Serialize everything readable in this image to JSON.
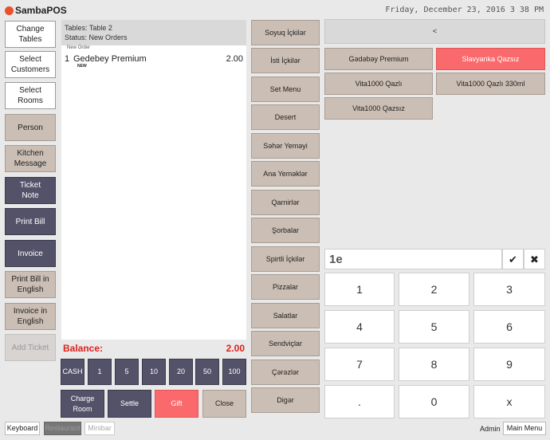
{
  "app": {
    "logo_text": "SambaPOS",
    "datetime": "Friday, December 23, 2016 3 38 PM"
  },
  "left_buttons": [
    "Change Tables",
    "Select Customers",
    "Select Rooms",
    "Person",
    "Kitchen Message",
    "Ticket Note",
    "Print Bill",
    "Invoice",
    "Print Bill in English",
    "Invoice in English",
    "Add Ticket"
  ],
  "ticket": {
    "table": "Tables: Table 2",
    "status": "Status: New Orders",
    "group_label": "New Order",
    "items": [
      {
        "qty": "1",
        "name": "Gedebey Premium",
        "price": "2.00",
        "tag": "NEW"
      }
    ],
    "balance_label": "Balance:",
    "balance_value": "2.00"
  },
  "cash_row": [
    "CASH",
    "1",
    "5",
    "10",
    "20",
    "50",
    "100"
  ],
  "action_row": [
    "Charge Room",
    "Settle",
    "Gift",
    "Close"
  ],
  "categories": [
    "Soyuq İçkilər",
    "İsti İçkilər",
    "Set Menu",
    "Desert",
    "Səhər Yeməyi",
    "Ana Yeməklər",
    "Qarnirlər",
    "Şorbalar",
    "Spirtli İçkilər",
    "Pizzalar",
    "Salatlar",
    "Sendviçlar",
    "Çərəzlər",
    "Digər"
  ],
  "products": {
    "back_label": "<",
    "items": [
      "Gədəbəy Premium",
      "Slavyanka Qazsız",
      "Vita1000 Qazlı",
      "Vita1000 Qazlı 330ml",
      "Vita1000 Qazsız"
    ]
  },
  "numpad": {
    "input_value": "1e",
    "check": "✔",
    "clear": "✖",
    "keys": [
      "1",
      "2",
      "3",
      "4",
      "5",
      "6",
      "7",
      "8",
      "9",
      ".",
      "0",
      "x"
    ]
  },
  "footer": {
    "keyboard": "Keyboard",
    "restaurant": "Restaurant",
    "minibar": "Minibar",
    "user": "Admin",
    "main_menu": "Main Menu"
  },
  "colors": {
    "dark_button": "#545269",
    "tan_button": "#cbbeb4",
    "accent_red": "#fa6a6c",
    "balance_red": "#e0201b"
  }
}
